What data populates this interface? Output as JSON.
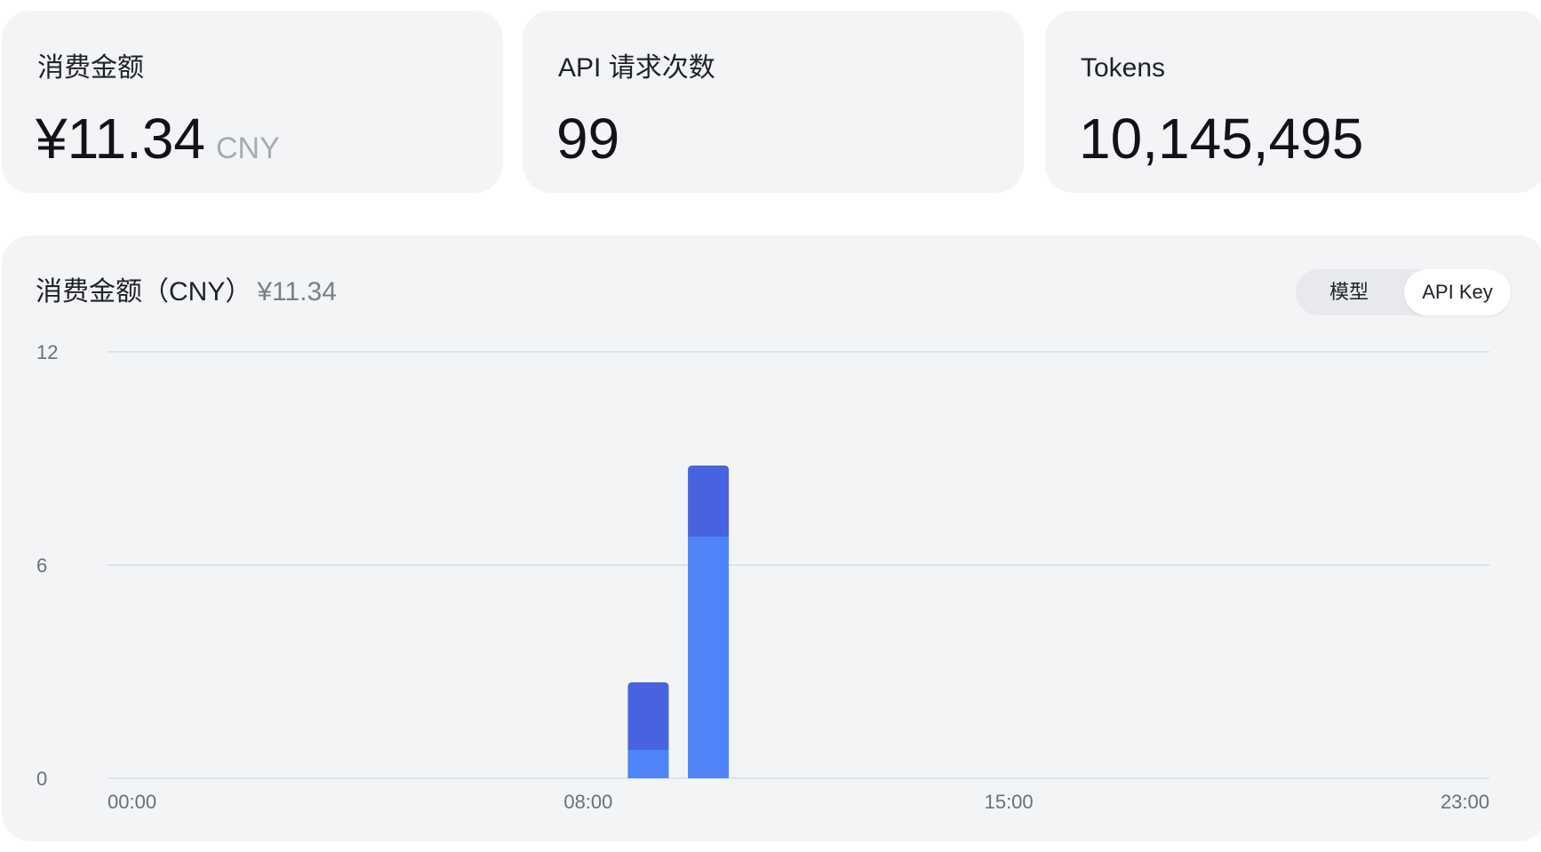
{
  "stats": [
    {
      "label": "消费金额",
      "value": "¥11.34",
      "unit": "CNY"
    },
    {
      "label": "API 请求次数",
      "value": "99"
    },
    {
      "label": "Tokens",
      "value": "10,145,495"
    }
  ],
  "chart_panel": {
    "title": "消费金额（CNY）",
    "total": "¥11.34",
    "toggle": {
      "options": [
        "模型",
        "API Key"
      ],
      "selected": "API Key"
    }
  },
  "colors": {
    "card_bg": "#f3f4f6",
    "series_light": "#4e84f7",
    "series_dark": "#4763df",
    "grid": "#d7dbe3"
  },
  "chart_data": {
    "type": "bar",
    "stacked": true,
    "title": "消费金额（CNY）",
    "ylim": [
      0,
      12
    ],
    "yticks": [
      "12",
      "6",
      "0"
    ],
    "x_ticks": [
      {
        "label": "00:00",
        "hour": 0
      },
      {
        "label": "08:00",
        "hour": 8
      },
      {
        "label": "15:00",
        "hour": 15
      },
      {
        "label": "23:00",
        "hour": 23
      }
    ],
    "grid": true,
    "legend": "none",
    "series": [
      {
        "color": "#4e84f7",
        "values": [
          {
            "hour": 9,
            "value": 0.8
          },
          {
            "hour": 10,
            "value": 6.8
          }
        ]
      },
      {
        "color": "#4763df",
        "values": [
          {
            "hour": 9,
            "value": 1.9
          },
          {
            "hour": 10,
            "value": 2.0
          }
        ]
      }
    ]
  }
}
